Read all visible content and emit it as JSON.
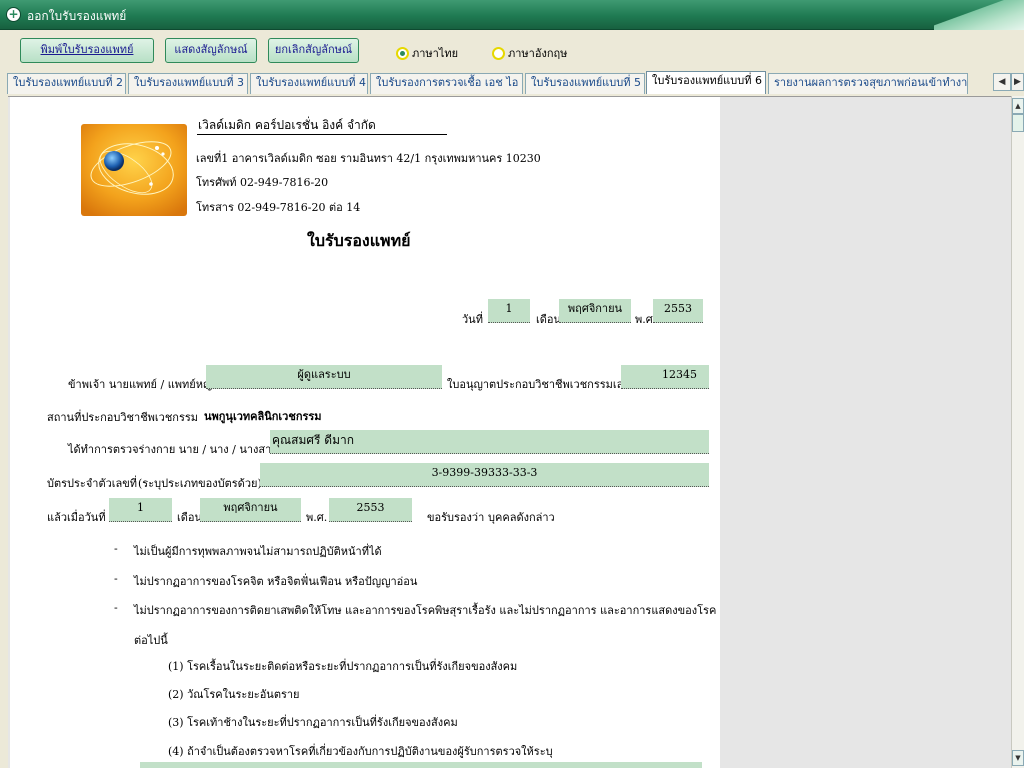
{
  "window": {
    "title": "ออกใบรับรองแพทย์"
  },
  "toolbar": {
    "print_label": "พิมพ์ใบรับรองแพทย์",
    "show_sign_label": "แสดงสัญลักษณ์",
    "cancel_sign_label": "ยกเลิกสัญลักษณ์",
    "lang_thai": "ภาษาไทย",
    "lang_english": "ภาษาอังกฤษ"
  },
  "tabs": [
    "ใบรับรองแพทย์แบบที่ 2",
    "ใบรับรองแพทย์แบบที่ 3",
    "ใบรับรองแพทย์แบบที่ 4",
    "ใบรับรองการตรวจเชื้อ เอช ไอ วี",
    "ใบรับรองแพทย์แบบที่ 5",
    "ใบรับรองแพทย์แบบที่ 6",
    "รายงานผลการตรวจสุขภาพก่อนเข้าทำงาน"
  ],
  "document": {
    "company_name": "เวิลด์เมดิก คอร์ปอเรชั่น อิงค์ จำกัด",
    "address": "เลขที่1 อาคารเวิลด์เมดิก ซอย รามอินทรา 42/1 กรุงเทพมหานคร 10230",
    "phone": "โทรศัพท์ 02-949-7816-20",
    "fax": "โทรสาร 02-949-7816-20 ต่อ 14",
    "heading": "ใบรับรองแพทย์",
    "date_label_day": "วันที่",
    "date_day": "1",
    "date_label_month": "เดือน",
    "date_month": "พฤศจิกายน",
    "date_label_year": "พ.ศ.",
    "date_year": "2553",
    "doctor_label": "ข้าพเจ้า นายแพทย์ / แพทย์หญิง",
    "doctor_name": "ผู้ดูแลระบบ",
    "license_label": "ใบอนุญาตประกอบวิชาชีพเวชกรรมเลขที่",
    "license_no": "12345",
    "clinic_label": "สถานที่ประกอบวิชาชีพเวชกรรม",
    "clinic_name": "นพกูนุเวทคลินิกเวชกรรม",
    "exam_label": "ได้ทำการตรวจร่างกาย นาย / นาง / นางสาว",
    "patient_name": "คุณสมศรี ดีมาก",
    "id_label": "บัตรประจำตัวเลขที่",
    "id_hint": "(ระบุประเภทของบัตรด้วย)",
    "id_no": "3-9399-39333-33-3",
    "exam_date_label": "แล้วเมื่อวันที่",
    "exam_day": "1",
    "exam_month_label": "เดือน",
    "exam_month": "พฤศจิกายน",
    "exam_year_label": "พ.ศ.",
    "exam_year": "2553",
    "certify_label": "ขอรับรองว่า",
    "person_label": "บุคคลดังกล่าว",
    "bullet_1": "ไม่เป็นผู้มีการทุพพลภาพจนไม่สามารถปฏิบัติหน้าที่ได้",
    "bullet_2": "ไม่ปรากฏอาการของโรคจิต  หรือจิตฟั่นเฟือน  หรือปัญญาอ่อน",
    "bullet_3": "ไม่ปรากฏอาการของการติดยาเสพติดให้โทษ  และอาการของโรคพิษสุราเรื้อรัง และไม่ปรากฏอาการ และอาการแสดงของโรค",
    "continue_label": "ต่อไปนี้",
    "item_1": "(1)  โรคเรื้อนในระยะติดต่อหรือระยะที่ปรากฏอาการเป็นที่รังเกียจของสังคม",
    "item_2": "(2)  วัณโรคในระยะอันตราย",
    "item_3": "(3)  โรคเท้าช้างในระยะที่ปรากฏอาการเป็นที่รังเกียจของสังคม",
    "item_4": "(4)  ถ้าจำเป็นต้องตรวจหาโรคที่เกี่ยวข้องกับการปฏิบัติงานของผู้รับการตรวจให้ระบุ",
    "bullet_mark": "-"
  },
  "colors": {
    "field_bg": "#c2e0c8",
    "titlebar": "#1f7a52",
    "accent_button": "#b8e0c6"
  }
}
